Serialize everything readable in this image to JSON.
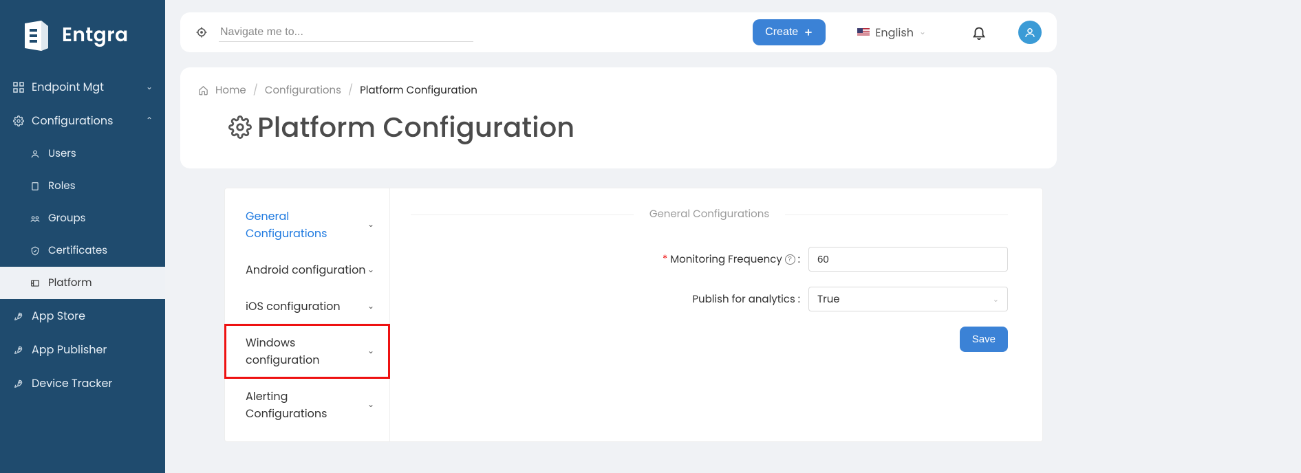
{
  "brand": "Entgra",
  "topbar": {
    "nav_placeholder": "Navigate me to...",
    "create_label": "Create",
    "language": "English"
  },
  "sidebar": {
    "items": [
      {
        "label": "Endpoint Mgt",
        "expandable": true,
        "expanded": false
      },
      {
        "label": "Configurations",
        "expandable": true,
        "expanded": true,
        "children": [
          {
            "label": "Users"
          },
          {
            "label": "Roles"
          },
          {
            "label": "Groups"
          },
          {
            "label": "Certificates"
          },
          {
            "label": "Platform",
            "active": true
          }
        ]
      },
      {
        "label": "App Store"
      },
      {
        "label": "App Publisher"
      },
      {
        "label": "Device Tracker"
      }
    ]
  },
  "breadcrumb": {
    "home": "Home",
    "section": "Configurations",
    "current": "Platform Configuration"
  },
  "page_title": "Platform Configuration",
  "config_tabs": [
    {
      "label": "General Configurations",
      "active": true
    },
    {
      "label": "Android configuration"
    },
    {
      "label": "iOS configuration"
    },
    {
      "label": "Windows configuration",
      "highlighted": true
    },
    {
      "label": "Alerting Configurations"
    }
  ],
  "panel": {
    "title": "General Configurations",
    "monitoring_label": "Monitoring Frequency",
    "monitoring_value": "60",
    "analytics_label": "Publish for analytics",
    "analytics_value": "True",
    "save_label": "Save"
  }
}
